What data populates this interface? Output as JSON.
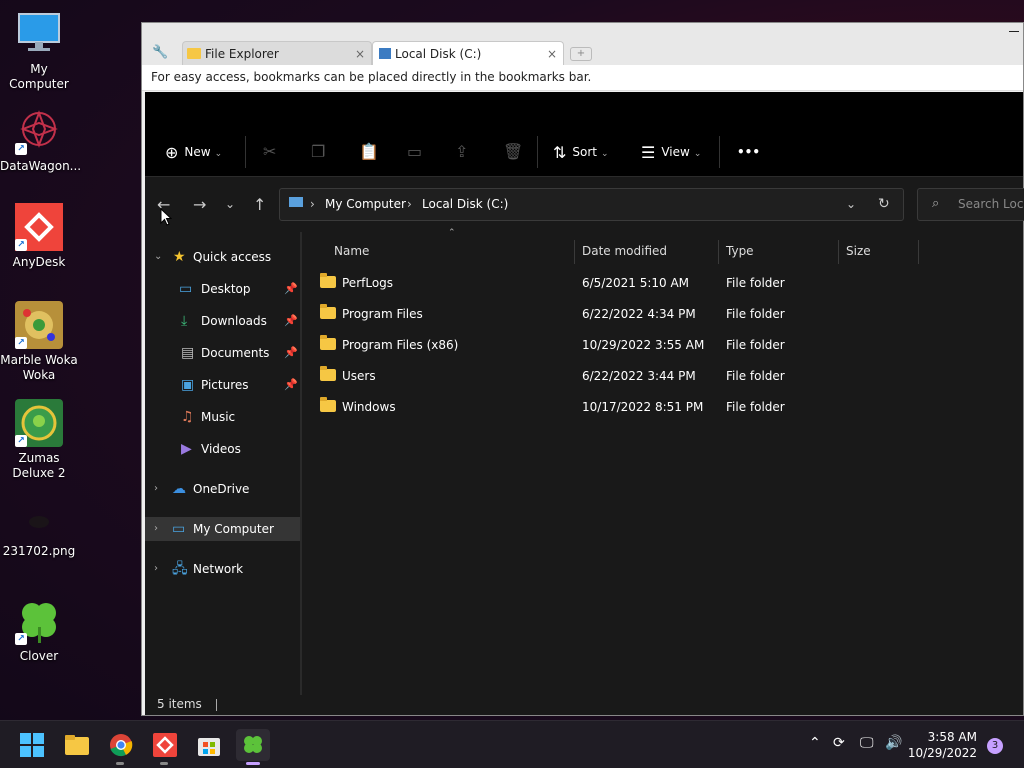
{
  "desktop": {
    "icons": [
      {
        "label": "My Computer"
      },
      {
        "label": "DataWagon..."
      },
      {
        "label": "AnyDesk"
      },
      {
        "label": "Marble Woka Woka"
      },
      {
        "label": "Zumas Deluxe 2"
      },
      {
        "label": "231702.png"
      },
      {
        "label": "Clover"
      }
    ]
  },
  "browser": {
    "tabs": [
      {
        "label": "File Explorer",
        "close": "×"
      },
      {
        "label": "Local Disk (C:)",
        "close": "×"
      }
    ],
    "bookmarks_hint": "For easy access, bookmarks can be placed directly in the bookmarks bar."
  },
  "explorer": {
    "ribbon": {
      "new_label": "New",
      "sort_label": "Sort",
      "view_label": "View",
      "more_label": "•••"
    },
    "address": {
      "crumbs": [
        "My Computer",
        "Local Disk (C:)"
      ],
      "search_placeholder": "Search Local"
    },
    "nav": {
      "quick_access": "Quick access",
      "items": [
        {
          "label": "Desktop",
          "icon": "desktop-icon"
        },
        {
          "label": "Downloads",
          "icon": "download-icon"
        },
        {
          "label": "Documents",
          "icon": "document-icon"
        },
        {
          "label": "Pictures",
          "icon": "pictures-icon"
        },
        {
          "label": "Music",
          "icon": "music-icon"
        },
        {
          "label": "Videos",
          "icon": "videos-icon"
        }
      ],
      "onedrive": "OneDrive",
      "my_computer": "My Computer",
      "network": "Network"
    },
    "columns": {
      "name": "Name",
      "date_modified": "Date modified",
      "type": "Type",
      "size": "Size"
    },
    "files": [
      {
        "name": "PerfLogs",
        "date": "6/5/2021 5:10 AM",
        "type": "File folder",
        "size": ""
      },
      {
        "name": "Program Files",
        "date": "6/22/2022 4:34 PM",
        "type": "File folder",
        "size": ""
      },
      {
        "name": "Program Files (x86)",
        "date": "10/29/2022 3:55 AM",
        "type": "File folder",
        "size": ""
      },
      {
        "name": "Users",
        "date": "6/22/2022 3:44 PM",
        "type": "File folder",
        "size": ""
      },
      {
        "name": "Windows",
        "date": "10/17/2022 8:51 PM",
        "type": "File folder",
        "size": ""
      }
    ],
    "status": "5 items"
  },
  "taskbar": {
    "time": "3:58 AM",
    "date": "10/29/2022",
    "notifications": "3"
  },
  "colors": {
    "accent": "#c6a0ff",
    "folder": "#f6c744",
    "explorer_bg": "#191919"
  }
}
